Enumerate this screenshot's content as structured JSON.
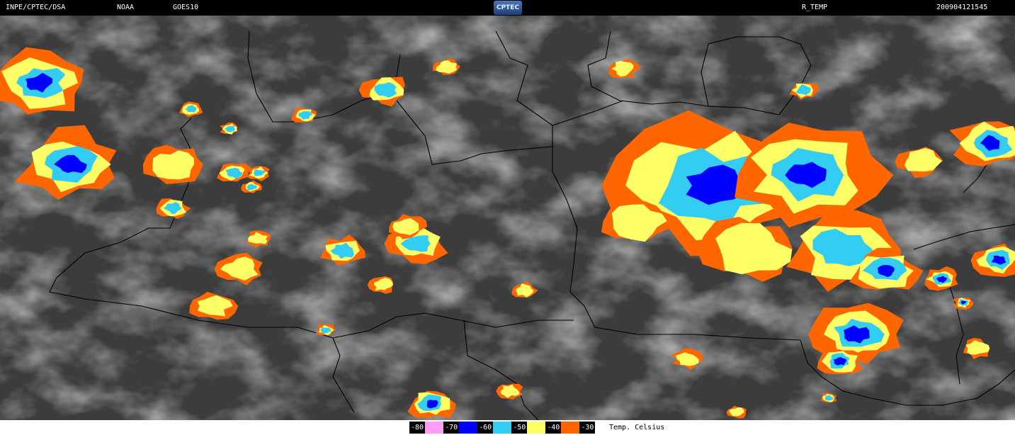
{
  "header": {
    "source": "INPE/CPTEC/DSA",
    "agency": "NOAA",
    "satellite": "GOES10",
    "logo_text": "CPTEC",
    "product": "R_TEMP",
    "timestamp": "200904121545"
  },
  "legend": {
    "entries": [
      {
        "label": "-80",
        "color": "#ff9cf5"
      },
      {
        "label": "-70",
        "color": "#0000ff"
      },
      {
        "label": "-60",
        "color": "#33ccf2"
      },
      {
        "label": "-50",
        "color": "#ffff66"
      },
      {
        "label": "-40",
        "color": "#ff6600"
      },
      {
        "label": "-30",
        "color": ""
      }
    ],
    "caption": "Temp. Celsius"
  },
  "palette": {
    "orange": "#ff6600",
    "yellow": "#ffff66",
    "cyan": "#33ccf2",
    "blue": "#0000ff",
    "pink": "#ff9cf5",
    "background_gray": "#3c3c3c",
    "cloud_gray": "#8c8c8c",
    "border_line": "#000000"
  }
}
